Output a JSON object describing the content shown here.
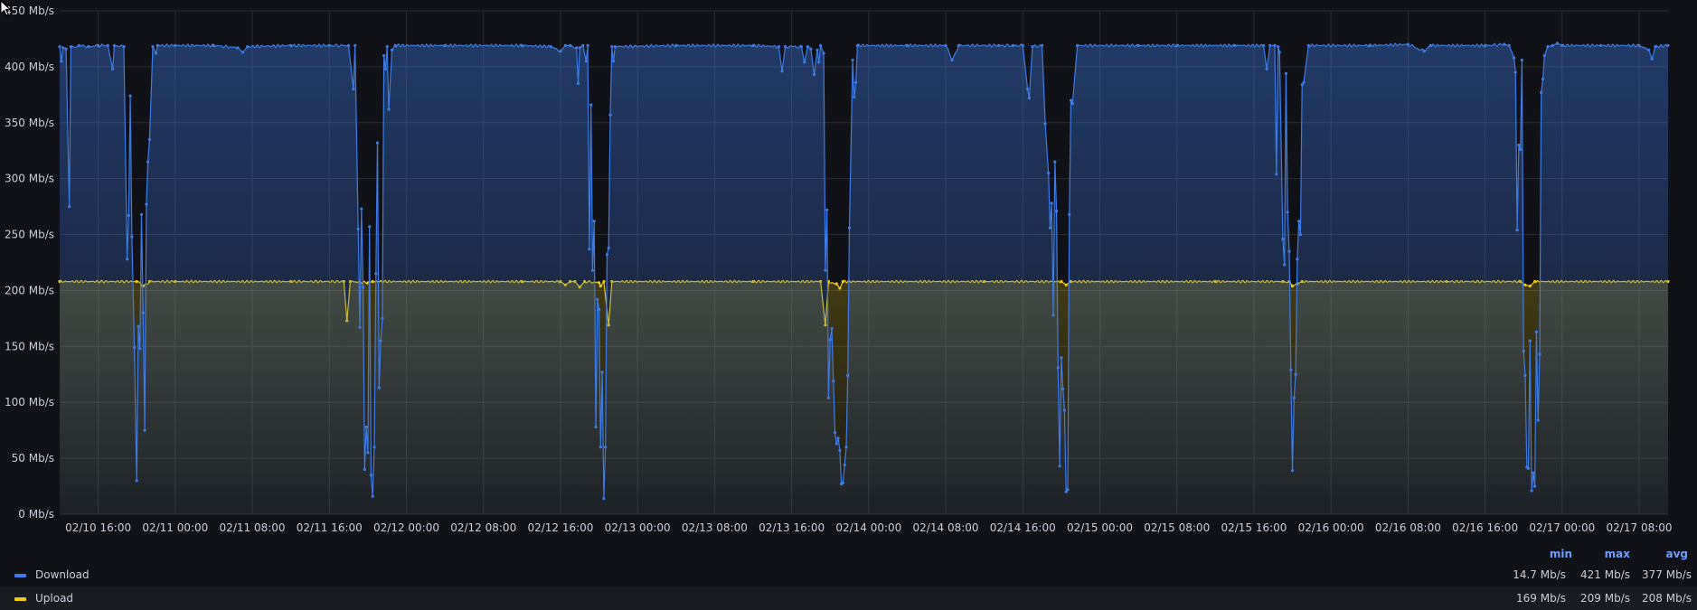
{
  "colors": {
    "background": "#111217",
    "grid": "#2a2c33",
    "download": "#3d7ce8",
    "upload": "#f2cc0c",
    "header": "#6e9fff",
    "text": "#ccccdc"
  },
  "legend": {
    "headers": {
      "min": "min",
      "max": "max",
      "avg": "avg"
    },
    "rows": [
      {
        "name": "Download",
        "color": "#3d7ce8",
        "min": "14.7 Mb/s",
        "max": "421 Mb/s",
        "avg": "377 Mb/s"
      },
      {
        "name": "Upload",
        "color": "#f2cc0c",
        "min": "169 Mb/s",
        "max": "209 Mb/s",
        "avg": "208 Mb/s"
      }
    ]
  },
  "chart_data": {
    "type": "area",
    "title": "",
    "xlabel": "",
    "ylabel": "",
    "y_unit": "Mb/s",
    "ylim": [
      0,
      450
    ],
    "yticks": [
      0,
      50,
      100,
      150,
      200,
      250,
      300,
      350,
      400,
      450
    ],
    "ytick_labels": [
      "0 Mb/s",
      "50 Mb/s",
      "100 Mb/s",
      "150 Mb/s",
      "200 Mb/s",
      "250 Mb/s",
      "300 Mb/s",
      "350 Mb/s",
      "400 Mb/s",
      "450 Mb/s"
    ],
    "x_range": [
      "02/10 12:00",
      "02/17 11:00"
    ],
    "xticks": [
      "02/10 16:00",
      "02/11 00:00",
      "02/11 08:00",
      "02/11 16:00",
      "02/12 00:00",
      "02/12 08:00",
      "02/12 16:00",
      "02/13 00:00",
      "02/13 08:00",
      "02/13 16:00",
      "02/14 00:00",
      "02/14 08:00",
      "02/14 16:00",
      "02/15 00:00",
      "02/15 08:00",
      "02/15 16:00",
      "02/16 00:00",
      "02/16 08:00",
      "02/16 16:00",
      "02/17 00:00",
      "02/17 08:00"
    ],
    "grid": true,
    "legend_position": "bottom",
    "series": [
      {
        "name": "Download",
        "color": "#3d7ce8",
        "points": [
          [
            "02/10 12:00",
            418
          ],
          [
            "02/10 12:10",
            405
          ],
          [
            "02/10 12:20",
            417
          ],
          [
            "02/10 12:40",
            416
          ],
          [
            "02/10 13:00",
            275
          ],
          [
            "02/10 13:10",
            418
          ],
          [
            "02/10 14:00",
            419
          ],
          [
            "02/10 15:00",
            418
          ],
          [
            "02/10 16:00",
            419
          ],
          [
            "02/10 17:00",
            419
          ],
          [
            "02/10 17:30",
            398
          ],
          [
            "02/10 17:40",
            419
          ],
          [
            "02/10 18:40",
            418
          ],
          [
            "02/10 19:00",
            228
          ],
          [
            "02/10 19:10",
            267
          ],
          [
            "02/10 19:20",
            374
          ],
          [
            "02/10 19:30",
            248
          ],
          [
            "02/10 19:45",
            149
          ],
          [
            "02/10 20:00",
            30
          ],
          [
            "02/10 20:10",
            168
          ],
          [
            "02/10 20:20",
            148
          ],
          [
            "02/10 20:30",
            268
          ],
          [
            "02/10 20:40",
            180
          ],
          [
            "02/10 20:50",
            75
          ],
          [
            "02/10 21:00",
            277
          ],
          [
            "02/10 21:10",
            315
          ],
          [
            "02/10 21:20",
            335
          ],
          [
            "02/10 21:40",
            418
          ],
          [
            "02/10 22:00",
            412
          ],
          [
            "02/10 22:10",
            419
          ],
          [
            "02/11 00:00",
            419
          ],
          [
            "02/11 04:00",
            419
          ],
          [
            "02/11 06:30",
            417
          ],
          [
            "02/11 07:00",
            413
          ],
          [
            "02/11 07:30",
            418
          ],
          [
            "02/11 12:00",
            419
          ],
          [
            "02/11 16:00",
            419
          ],
          [
            "02/11 18:00",
            419
          ],
          [
            "02/11 18:30",
            380
          ],
          [
            "02/11 18:40",
            419
          ],
          [
            "02/11 19:00",
            255
          ],
          [
            "02/11 19:10",
            167
          ],
          [
            "02/11 19:20",
            273
          ],
          [
            "02/11 19:30",
            203
          ],
          [
            "02/11 19:40",
            40
          ],
          [
            "02/11 19:50",
            78
          ],
          [
            "02/11 20:00",
            55
          ],
          [
            "02/11 20:10",
            257
          ],
          [
            "02/11 20:20",
            35
          ],
          [
            "02/11 20:30",
            16
          ],
          [
            "02/11 20:40",
            60
          ],
          [
            "02/11 20:50",
            215
          ],
          [
            "02/11 21:00",
            332
          ],
          [
            "02/11 21:10",
            113
          ],
          [
            "02/11 21:20",
            155
          ],
          [
            "02/11 21:30",
            175
          ],
          [
            "02/11 21:40",
            410
          ],
          [
            "02/11 21:50",
            398
          ],
          [
            "02/11 22:00",
            418
          ],
          [
            "02/11 22:10",
            362
          ],
          [
            "02/11 22:30",
            415
          ],
          [
            "02/11 22:50",
            419
          ],
          [
            "02/12 04:00",
            419
          ],
          [
            "02/12 12:00",
            419
          ],
          [
            "02/12 15:00",
            418
          ],
          [
            "02/12 16:00",
            414
          ],
          [
            "02/12 16:30",
            419
          ],
          [
            "02/12 17:00",
            419
          ],
          [
            "02/12 17:40",
            417
          ],
          [
            "02/12 17:50",
            385
          ],
          [
            "02/12 18:00",
            417
          ],
          [
            "02/12 18:20",
            419
          ],
          [
            "02/12 18:40",
            405
          ],
          [
            "02/12 18:50",
            419
          ],
          [
            "02/12 19:00",
            237
          ],
          [
            "02/12 19:10",
            366
          ],
          [
            "02/12 19:20",
            218
          ],
          [
            "02/12 19:30",
            262
          ],
          [
            "02/12 19:40",
            78
          ],
          [
            "02/12 19:50",
            192
          ],
          [
            "02/12 20:00",
            183
          ],
          [
            "02/12 20:10",
            60
          ],
          [
            "02/12 20:20",
            127
          ],
          [
            "02/12 20:30",
            14
          ],
          [
            "02/12 20:40",
            60
          ],
          [
            "02/12 20:50",
            232
          ],
          [
            "02/12 21:00",
            238
          ],
          [
            "02/12 21:10",
            357
          ],
          [
            "02/12 21:20",
            418
          ],
          [
            "02/12 21:30",
            405
          ],
          [
            "02/12 21:40",
            418
          ],
          [
            "02/13 04:00",
            419
          ],
          [
            "02/13 12:00",
            419
          ],
          [
            "02/13 14:40",
            418
          ],
          [
            "02/13 15:00",
            396
          ],
          [
            "02/13 15:20",
            418
          ],
          [
            "02/13 17:00",
            418
          ],
          [
            "02/13 17:20",
            404
          ],
          [
            "02/13 17:40",
            418
          ],
          [
            "02/13 18:00",
            416
          ],
          [
            "02/13 18:20",
            393
          ],
          [
            "02/13 18:40",
            415
          ],
          [
            "02/13 18:50",
            404
          ],
          [
            "02/13 19:00",
            419
          ],
          [
            "02/13 19:20",
            412
          ],
          [
            "02/13 19:30",
            218
          ],
          [
            "02/13 19:40",
            272
          ],
          [
            "02/13 19:50",
            104
          ],
          [
            "02/13 20:00",
            156
          ],
          [
            "02/13 20:10",
            166
          ],
          [
            "02/13 20:20",
            119
          ],
          [
            "02/13 20:30",
            73
          ],
          [
            "02/13 20:40",
            63
          ],
          [
            "02/13 20:50",
            68
          ],
          [
            "02/13 21:00",
            57
          ],
          [
            "02/13 21:10",
            27
          ],
          [
            "02/13 21:20",
            28
          ],
          [
            "02/13 21:30",
            44
          ],
          [
            "02/13 21:40",
            60
          ],
          [
            "02/13 21:50",
            124
          ],
          [
            "02/13 22:00",
            256
          ],
          [
            "02/13 22:20",
            406
          ],
          [
            "02/13 22:30",
            373
          ],
          [
            "02/13 22:40",
            386
          ],
          [
            "02/13 22:50",
            419
          ],
          [
            "02/14 04:00",
            419
          ],
          [
            "02/14 08:00",
            419
          ],
          [
            "02/14 08:40",
            406
          ],
          [
            "02/14 09:20",
            419
          ],
          [
            "02/14 13:30",
            419
          ],
          [
            "02/14 15:00",
            419
          ],
          [
            "02/14 16:00",
            419
          ],
          [
            "02/14 16:30",
            380
          ],
          [
            "02/14 16:40",
            372
          ],
          [
            "02/14 17:00",
            418
          ],
          [
            "02/14 18:00",
            419
          ],
          [
            "02/14 18:20",
            349
          ],
          [
            "02/14 18:40",
            305
          ],
          [
            "02/14 18:50",
            256
          ],
          [
            "02/14 19:00",
            278
          ],
          [
            "02/14 19:10",
            178
          ],
          [
            "02/14 19:20",
            315
          ],
          [
            "02/14 19:30",
            271
          ],
          [
            "02/14 19:40",
            131
          ],
          [
            "02/14 19:50",
            43
          ],
          [
            "02/14 20:00",
            140
          ],
          [
            "02/14 20:10",
            112
          ],
          [
            "02/14 20:20",
            93
          ],
          [
            "02/14 20:30",
            20
          ],
          [
            "02/14 20:40",
            22
          ],
          [
            "02/14 20:50",
            268
          ],
          [
            "02/14 21:00",
            370
          ],
          [
            "02/14 21:10",
            367
          ],
          [
            "02/14 21:40",
            419
          ],
          [
            "02/15 04:00",
            419
          ],
          [
            "02/15 08:00",
            419
          ],
          [
            "02/15 14:00",
            419
          ],
          [
            "02/15 17:00",
            419
          ],
          [
            "02/15 17:20",
            398
          ],
          [
            "02/15 17:40",
            419
          ],
          [
            "02/15 18:10",
            419
          ],
          [
            "02/15 18:20",
            304
          ],
          [
            "02/15 18:30",
            418
          ],
          [
            "02/15 18:40",
            413
          ],
          [
            "02/15 19:00",
            246
          ],
          [
            "02/15 19:10",
            223
          ],
          [
            "02/15 19:20",
            394
          ],
          [
            "02/15 19:30",
            270
          ],
          [
            "02/15 19:40",
            235
          ],
          [
            "02/15 19:50",
            129
          ],
          [
            "02/15 20:00",
            39
          ],
          [
            "02/15 20:10",
            104
          ],
          [
            "02/15 20:20",
            125
          ],
          [
            "02/15 20:30",
            228
          ],
          [
            "02/15 20:40",
            262
          ],
          [
            "02/15 20:50",
            250
          ],
          [
            "02/15 21:00",
            384
          ],
          [
            "02/15 21:10",
            386
          ],
          [
            "02/15 21:40",
            419
          ],
          [
            "02/16 04:00",
            419
          ],
          [
            "02/16 08:00",
            420
          ],
          [
            "02/16 09:40",
            414
          ],
          [
            "02/16 10:20",
            419
          ],
          [
            "02/16 16:00",
            419
          ],
          [
            "02/16 18:00",
            420
          ],
          [
            "02/16 18:30",
            419
          ],
          [
            "02/16 19:00",
            408
          ],
          [
            "02/16 19:10",
            395
          ],
          [
            "02/16 19:20",
            254
          ],
          [
            "02/16 19:30",
            330
          ],
          [
            "02/16 19:40",
            326
          ],
          [
            "02/16 19:50",
            406
          ],
          [
            "02/16 20:00",
            146
          ],
          [
            "02/16 20:10",
            124
          ],
          [
            "02/16 20:20",
            42
          ],
          [
            "02/16 20:30",
            41
          ],
          [
            "02/16 20:40",
            155
          ],
          [
            "02/16 20:50",
            21
          ],
          [
            "02/16 21:00",
            37
          ],
          [
            "02/16 21:10",
            25
          ],
          [
            "02/16 21:20",
            163
          ],
          [
            "02/16 21:30",
            84
          ],
          [
            "02/16 21:40",
            143
          ],
          [
            "02/16 21:50",
            377
          ],
          [
            "02/16 22:00",
            389
          ],
          [
            "02/16 22:10",
            410
          ],
          [
            "02/16 22:30",
            418
          ],
          [
            "02/16 23:00",
            419
          ],
          [
            "02/16 23:30",
            421
          ],
          [
            "02/17 00:00",
            419
          ],
          [
            "02/17 04:00",
            419
          ],
          [
            "02/17 08:00",
            419
          ],
          [
            "02/17 09:00",
            415
          ],
          [
            "02/17 09:20",
            407
          ],
          [
            "02/17 09:40",
            418
          ],
          [
            "02/17 11:00",
            419
          ]
        ]
      },
      {
        "name": "Upload",
        "color": "#f2cc0c",
        "points": [
          [
            "02/10 12:00",
            208
          ],
          [
            "02/10 20:00",
            208
          ],
          [
            "02/10 20:40",
            204
          ],
          [
            "02/10 21:20",
            208
          ],
          [
            "02/11 00:00",
            208
          ],
          [
            "02/11 12:00",
            208
          ],
          [
            "02/11 17:30",
            208
          ],
          [
            "02/11 17:50",
            173
          ],
          [
            "02/11 18:10",
            208
          ],
          [
            "02/11 20:00",
            207
          ],
          [
            "02/11 20:30",
            208
          ],
          [
            "02/12 12:00",
            208
          ],
          [
            "02/12 16:00",
            208
          ],
          [
            "02/12 16:30",
            205
          ],
          [
            "02/12 17:00",
            208
          ],
          [
            "02/12 17:30",
            208
          ],
          [
            "02/12 18:00",
            203
          ],
          [
            "02/12 18:30",
            208
          ],
          [
            "02/12 20:00",
            207
          ],
          [
            "02/12 20:10",
            204
          ],
          [
            "02/12 20:30",
            208
          ],
          [
            "02/12 21:00",
            169
          ],
          [
            "02/12 21:20",
            208
          ],
          [
            "02/13 12:00",
            208
          ],
          [
            "02/13 19:00",
            208
          ],
          [
            "02/13 19:30",
            169
          ],
          [
            "02/13 19:50",
            208
          ],
          [
            "02/13 20:40",
            206
          ],
          [
            "02/13 21:00",
            202
          ],
          [
            "02/13 21:20",
            208
          ],
          [
            "02/14 12:00",
            208
          ],
          [
            "02/14 20:00",
            208
          ],
          [
            "02/14 20:30",
            205
          ],
          [
            "02/14 21:00",
            208
          ],
          [
            "02/15 12:00",
            208
          ],
          [
            "02/15 19:00",
            208
          ],
          [
            "02/15 19:40",
            208
          ],
          [
            "02/15 20:00",
            204
          ],
          [
            "02/15 20:30",
            206
          ],
          [
            "02/15 21:00",
            208
          ],
          [
            "02/16 12:00",
            208
          ],
          [
            "02/16 19:40",
            208
          ],
          [
            "02/16 20:10",
            205
          ],
          [
            "02/16 20:40",
            204
          ],
          [
            "02/16 21:10",
            208
          ],
          [
            "02/17 11:00",
            208
          ]
        ]
      }
    ]
  }
}
